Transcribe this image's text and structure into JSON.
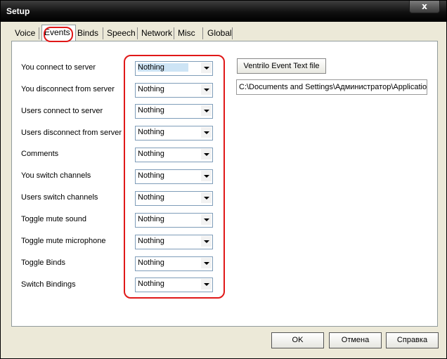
{
  "window": {
    "title": "Setup",
    "close_glyph": "x"
  },
  "tabs": [
    {
      "label": "Voice"
    },
    {
      "label": "Events"
    },
    {
      "label": "Binds"
    },
    {
      "label": "Speech"
    },
    {
      "label": "Network"
    },
    {
      "label": "Misc"
    },
    {
      "label": "Global"
    }
  ],
  "active_tab": "Events",
  "events": [
    {
      "label": "You connect to server",
      "value": "Nothing"
    },
    {
      "label": "You disconnect from server",
      "value": "Nothing"
    },
    {
      "label": "Users connect to server",
      "value": "Nothing"
    },
    {
      "label": "Users disconnect from server",
      "value": "Nothing"
    },
    {
      "label": "Comments",
      "value": "Nothing"
    },
    {
      "label": "You switch channels",
      "value": "Nothing"
    },
    {
      "label": "Users switch channels",
      "value": "Nothing"
    },
    {
      "label": "Toggle mute sound",
      "value": "Nothing"
    },
    {
      "label": "Toggle mute microphone",
      "value": "Nothing"
    },
    {
      "label": "Toggle Binds",
      "value": "Nothing"
    },
    {
      "label": "Switch Bindings",
      "value": "Nothing"
    }
  ],
  "event_text_button": "Ventrilo Event Text file",
  "event_text_path": "C:\\Documents and Settings\\Администратор\\Applicatio",
  "buttons": {
    "ok": "OK",
    "cancel": "Отмена",
    "help": "Справка"
  },
  "colors": {
    "highlight": "#e01818",
    "title_bar": "#101010",
    "dialog_bg": "#ece9d8"
  }
}
